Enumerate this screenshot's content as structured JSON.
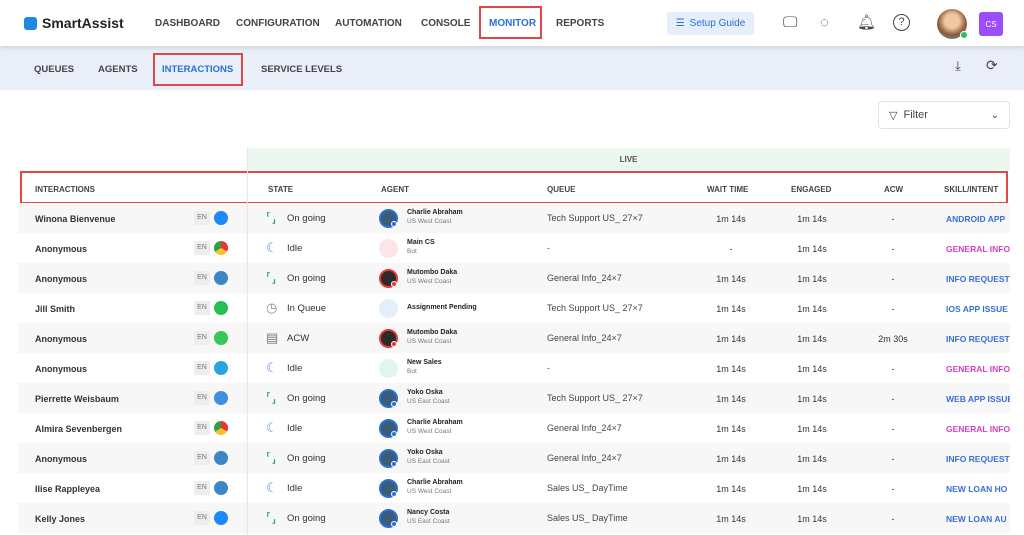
{
  "header": {
    "brand": "SmartAssist",
    "nav": [
      "DASHBOARD",
      "CONFIGURATION",
      "AUTOMATION",
      "CONSOLE",
      "MONITOR",
      "REPORTS"
    ],
    "active": "MONITOR",
    "setup_guide": "Setup Guide",
    "user_initials": "CS"
  },
  "subnav": {
    "tabs": [
      "QUEUES",
      "AGENTS",
      "INTERACTIONS",
      "SERVICE LEVELS"
    ],
    "active": "INTERACTIONS"
  },
  "filter": {
    "label": "Filter"
  },
  "table": {
    "group_label": "LIVE",
    "columns": [
      "INTERACTIONS",
      "STATE",
      "AGENT",
      "QUEUE",
      "WAIT TIME",
      "ENGAGED",
      "ACW",
      "SKILL/INTENT"
    ],
    "rows": [
      {
        "name": "Winona Bienvenue",
        "lang": "EN",
        "channel": "messenger",
        "state": "On going",
        "agent": "Charlie Abraham",
        "region": "US West Coast",
        "status": "blue",
        "queue": "Tech Support US_ 27×7",
        "wait": "1m 14s",
        "engaged": "1m 14s",
        "acw": "-",
        "skill": "ANDROID  APP",
        "skill_color": "#3a6fd8"
      },
      {
        "name": "Anonymous",
        "lang": "EN",
        "channel": "chrome",
        "state": "Idle",
        "agent": "Main CS",
        "region": "Bot",
        "status": "bot-red",
        "queue": "-",
        "wait": "-",
        "engaged": "1m 14s",
        "acw": "-",
        "skill": "GENERAL INFO",
        "skill_color": "#d63fc3"
      },
      {
        "name": "Anonymous",
        "lang": "EN",
        "channel": "phone",
        "state": "On going",
        "agent": "Mutombo Daka",
        "region": "US West Coast",
        "status": "red",
        "queue": "General Info_24×7",
        "wait": "1m 14s",
        "engaged": "1m 14s",
        "acw": "-",
        "skill": "INFO REQUEST",
        "skill_color": "#3a6fd8"
      },
      {
        "name": "Jill Smith",
        "lang": "EN",
        "channel": "whatsapp",
        "state": "In Queue",
        "agent": "Assignment Pending",
        "region": "",
        "status": "pending",
        "queue": "Tech Support US_ 27×7",
        "wait": "1m 14s",
        "engaged": "1m 14s",
        "acw": "-",
        "skill": "IOS  APP ISSUE",
        "skill_color": "#3a6fd8"
      },
      {
        "name": "Anonymous",
        "lang": "EN",
        "channel": "sms",
        "state": "ACW",
        "agent": "Mutombo Daka",
        "region": "US West Coast",
        "status": "red",
        "queue": "General Info_24×7",
        "wait": "1m 14s",
        "engaged": "1m 14s",
        "acw": "2m 30s",
        "skill": "INFO REQUEST",
        "skill_color": "#3a6fd8"
      },
      {
        "name": "Anonymous",
        "lang": "EN",
        "channel": "telegram",
        "state": "Idle",
        "agent": "New Sales",
        "region": "Bot",
        "status": "bot-green",
        "queue": "-",
        "wait": "1m 14s",
        "engaged": "1m 14s",
        "acw": "-",
        "skill": "GENERAL INFO",
        "skill_color": "#d63fc3"
      },
      {
        "name": "Pierrette Weisbaum",
        "lang": "EN",
        "channel": "safari",
        "state": "On going",
        "agent": "Yoko Oska",
        "region": "US East Coast",
        "status": "blue",
        "queue": "Tech Support US_ 27×7",
        "wait": "1m 14s",
        "engaged": "1m 14s",
        "acw": "-",
        "skill": "WEB  APP ISSUE",
        "skill_color": "#3a6fd8"
      },
      {
        "name": "Almira Sevenbergen",
        "lang": "EN",
        "channel": "chrome",
        "state": "Idle",
        "agent": "Charlie Abraham",
        "region": "US West Coast",
        "status": "blue",
        "queue": "General Info_24×7",
        "wait": "1m 14s",
        "engaged": "1m 14s",
        "acw": "-",
        "skill": "GENERAL INFO",
        "skill_color": "#d63fc3"
      },
      {
        "name": "Anonymous",
        "lang": "EN",
        "channel": "phone",
        "state": "On going",
        "agent": "Yoko Oska",
        "region": "US East Coast",
        "status": "blue",
        "queue": "General Info_24×7",
        "wait": "1m 14s",
        "engaged": "1m 14s",
        "acw": "-",
        "skill": "INFO REQUEST",
        "skill_color": "#3a6fd8"
      },
      {
        "name": "Ilise Rappleyea",
        "lang": "EN",
        "channel": "phone",
        "state": "Idle",
        "agent": "Charlie Abraham",
        "region": "US West Coast",
        "status": "blue",
        "queue": "Sales US_ DayTime",
        "wait": "1m 14s",
        "engaged": "1m 14s",
        "acw": "-",
        "skill": "NEW LOAN  HO",
        "skill_color": "#3a6fd8"
      },
      {
        "name": "Kelly Jones",
        "lang": "EN",
        "channel": "messenger",
        "state": "On going",
        "agent": "Nancy Costa",
        "region": "US East Coast",
        "status": "blue",
        "queue": "Sales US_ DayTime",
        "wait": "1m 14s",
        "engaged": "1m 14s",
        "acw": "-",
        "skill": "NEW LOAN  AU",
        "skill_color": "#3a6fd8"
      }
    ]
  }
}
